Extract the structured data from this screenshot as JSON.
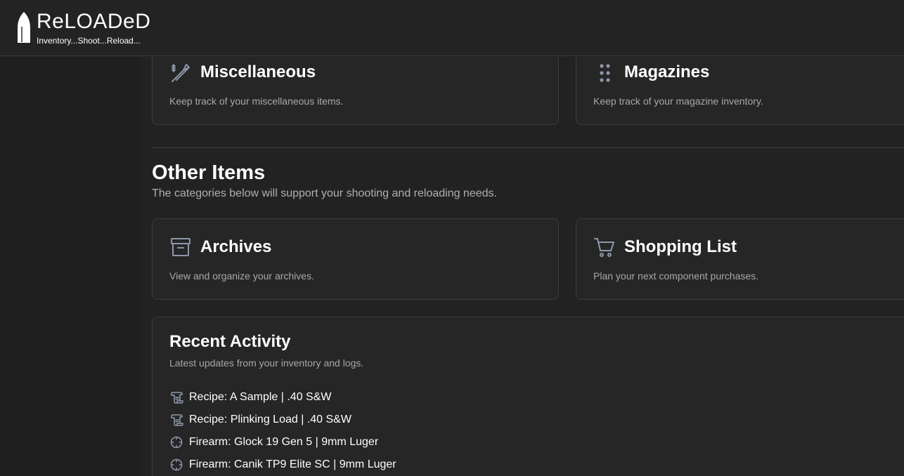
{
  "app": {
    "title": "ReLOADeD",
    "tagline": "Inventory...Shoot...Reload...",
    "logo_icon": "bullet-icon"
  },
  "categories": [
    {
      "title": "Miscellaneous",
      "description": "Keep track of your miscellaneous items.",
      "icon": "tools-icon"
    },
    {
      "title": "Magazines",
      "description": "Keep track of your magazine inventory.",
      "icon": "grip-dots-icon"
    }
  ],
  "other_items": {
    "title": "Other Items",
    "subtitle": "The categories below will support your shooting and reloading needs.",
    "cards": [
      {
        "title": "Archives",
        "description": "View and organize your archives.",
        "icon": "archive-icon"
      },
      {
        "title": "Shopping List",
        "description": "Plan your next component purchases.",
        "icon": "shopping-cart-icon"
      }
    ]
  },
  "recent_activity": {
    "title": "Recent Activity",
    "subtitle": "Latest updates from your inventory and logs.",
    "items": [
      {
        "text": "Recipe: A Sample | .40 S&W",
        "icon": "scroll-icon"
      },
      {
        "text": "Recipe: Plinking Load | .40 S&W",
        "icon": "scroll-icon"
      },
      {
        "text": "Firearm: Glock 19 Gen 5 | 9mm Luger",
        "icon": "crosshair-icon"
      },
      {
        "text": "Firearm: Canik TP9 Elite SC | 9mm Luger",
        "icon": "crosshair-icon"
      }
    ]
  },
  "colors": {
    "background": "#222223",
    "card": "#262627",
    "border": "#3d3d40",
    "icon": "#8e98aa",
    "muted_text": "#a8a8ac"
  }
}
